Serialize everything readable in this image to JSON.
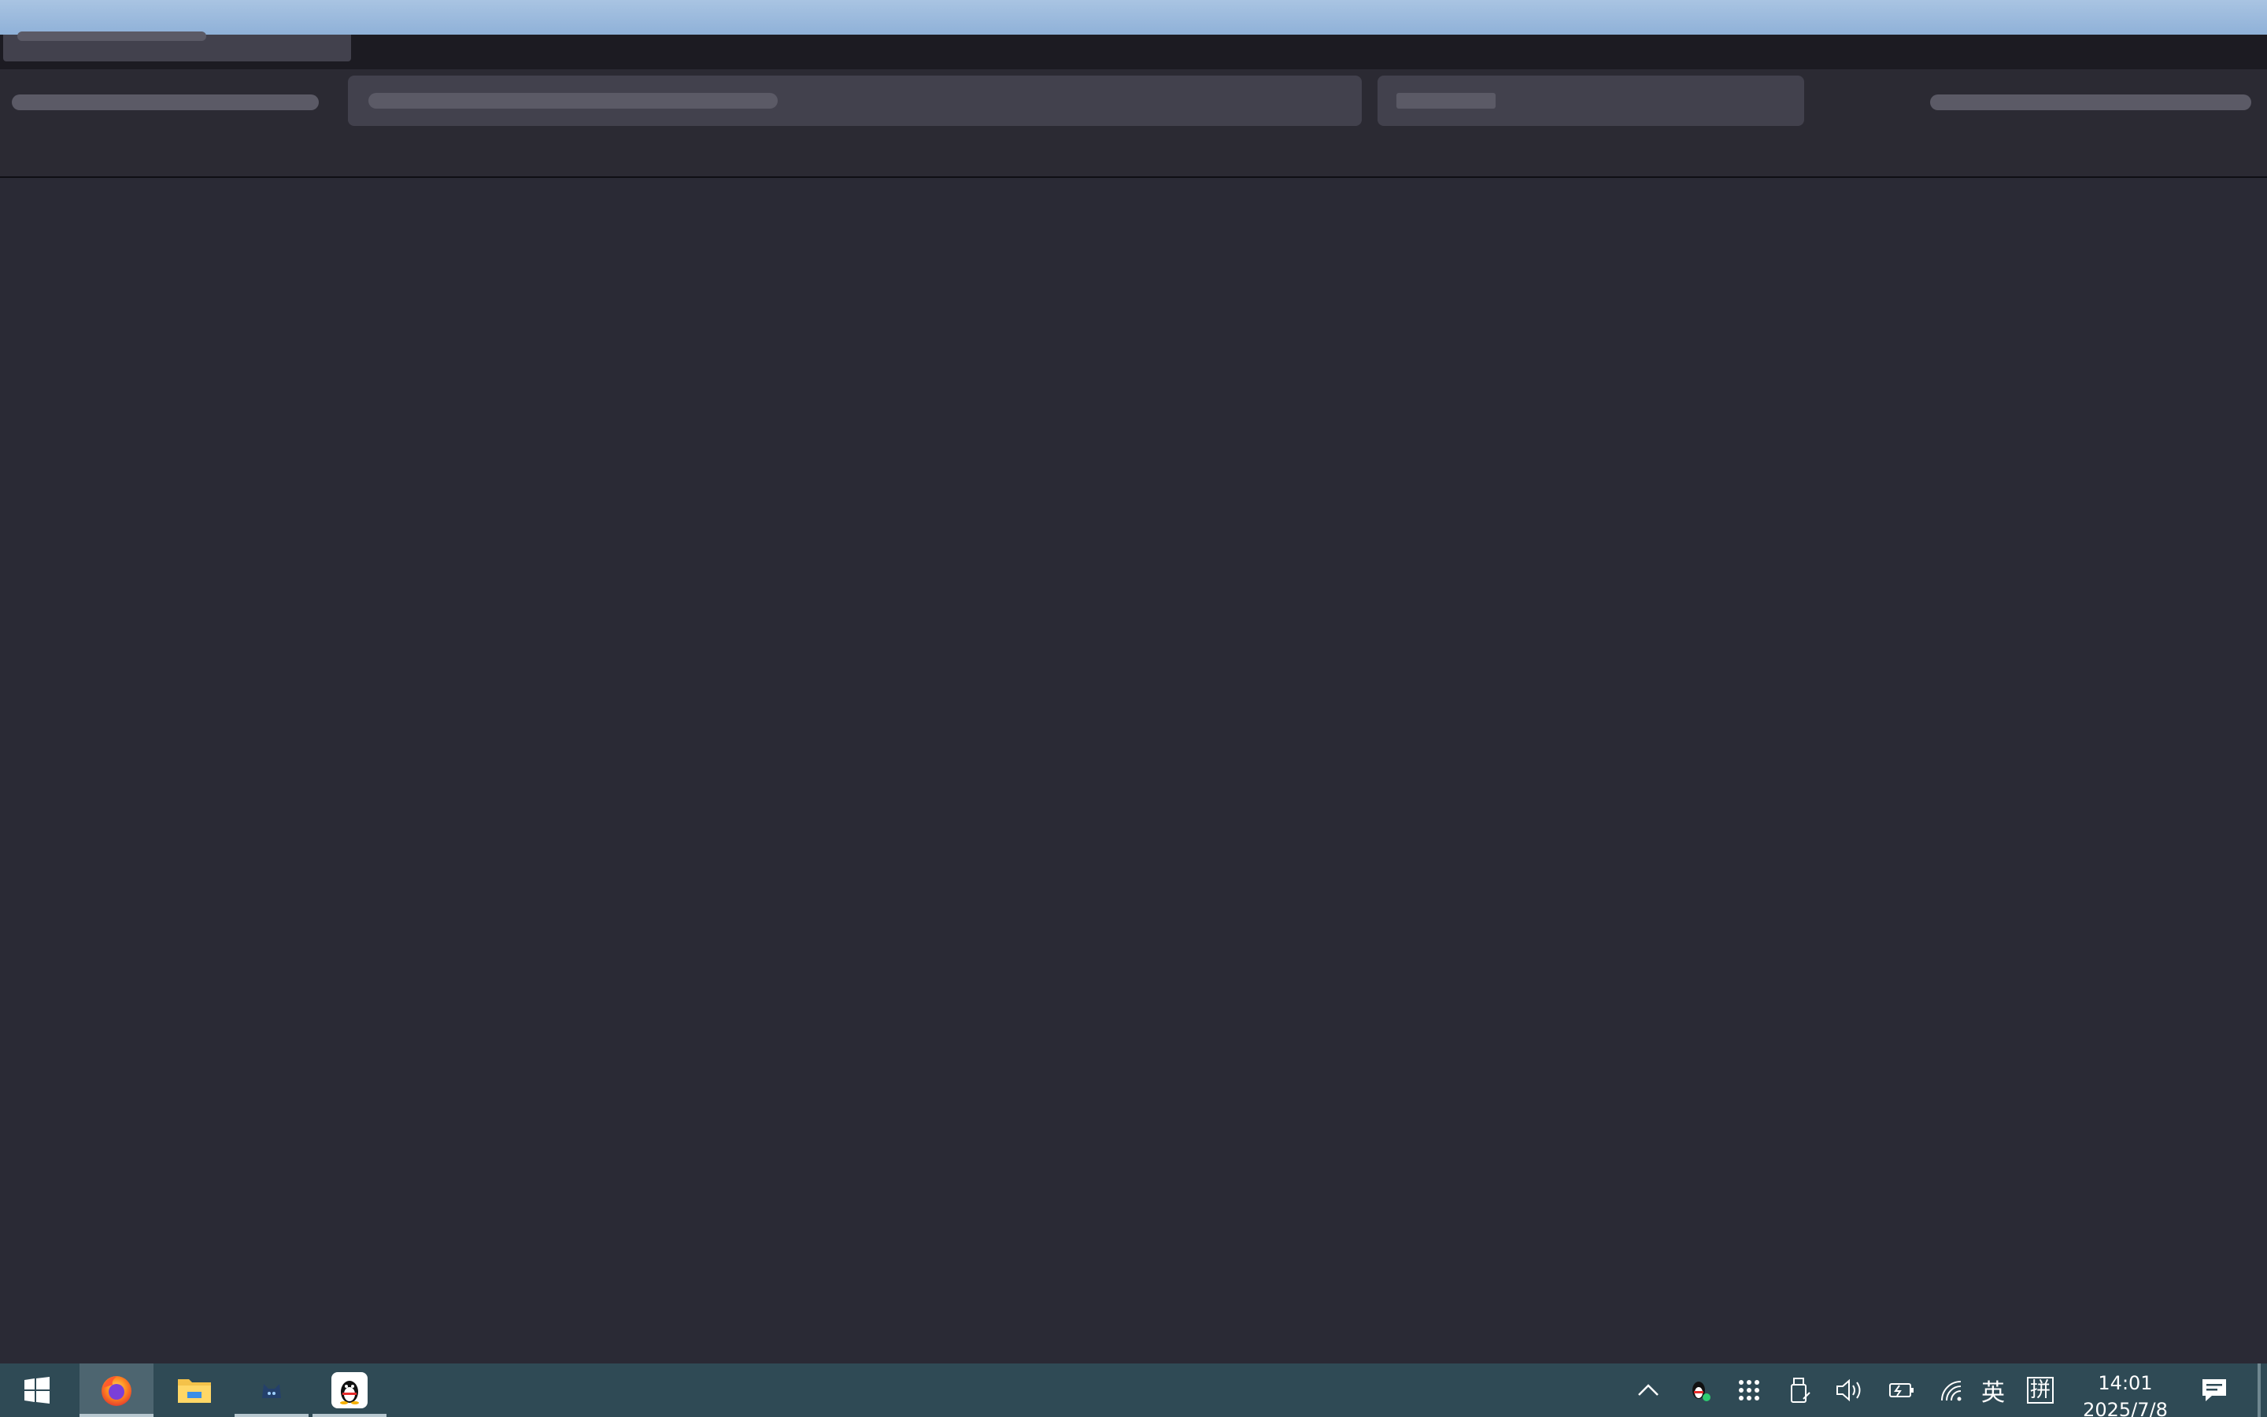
{
  "taskbar": {
    "clock": {
      "time": "14:01",
      "date": "2025/7/8"
    },
    "tray": {
      "ime_lang": "英",
      "ime_mode": "拼"
    }
  },
  "colors": {
    "title_strip": "#a9c4e2",
    "tabbar": "#1c1b22",
    "toolbar": "#2b2a33",
    "skeleton": "#5b5a66",
    "field": "#42414d",
    "content": "#2a2a35",
    "taskbar": "#2f4a55"
  }
}
